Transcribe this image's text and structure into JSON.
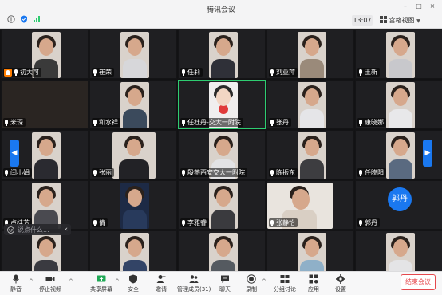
{
  "window": {
    "title": "腾讯会议",
    "time": "13:07",
    "view_mode": "宫格视图",
    "controls": [
      "–",
      "□",
      "×"
    ]
  },
  "participants": [
    {
      "name": "初大可",
      "host": true
    },
    {
      "name": "崔荣"
    },
    {
      "name": "任莉"
    },
    {
      "name": "刘亚萍"
    },
    {
      "name": "王新"
    },
    {
      "name": "米琛"
    },
    {
      "name": "和水祥"
    },
    {
      "name": "任杜丹-交大一附院"
    },
    {
      "name": "张丹"
    },
    {
      "name": "康晓娜"
    },
    {
      "name": "闫小娟"
    },
    {
      "name": "张丽"
    },
    {
      "name": "殷燕西安交大一附院"
    },
    {
      "name": "陈振东"
    },
    {
      "name": "任晓阳"
    },
    {
      "name": "卢桂芳"
    },
    {
      "name": "倩"
    },
    {
      "name": "李雅睿"
    },
    {
      "name": "张静怡"
    },
    {
      "name": "郭丹",
      "avatar_text": "郭丹"
    }
  ],
  "chat": {
    "placeholder": "说点什么..."
  },
  "toolbar": {
    "mute": "静音",
    "video": "停止视频",
    "share": "共享屏幕",
    "security": "安全",
    "invite": "邀请",
    "members": "管理成员(31)",
    "chat": "聊天",
    "record": "录制",
    "breakout": "分组讨论",
    "apps": "应用",
    "settings": "设置",
    "end": "结束会议"
  },
  "pager": {
    "prev": "◀",
    "next": "▶"
  },
  "colors": {
    "accent": "#1a78f0",
    "host": "#ff7d00",
    "active_border": "#2ecc71",
    "end": "#e5484d"
  }
}
